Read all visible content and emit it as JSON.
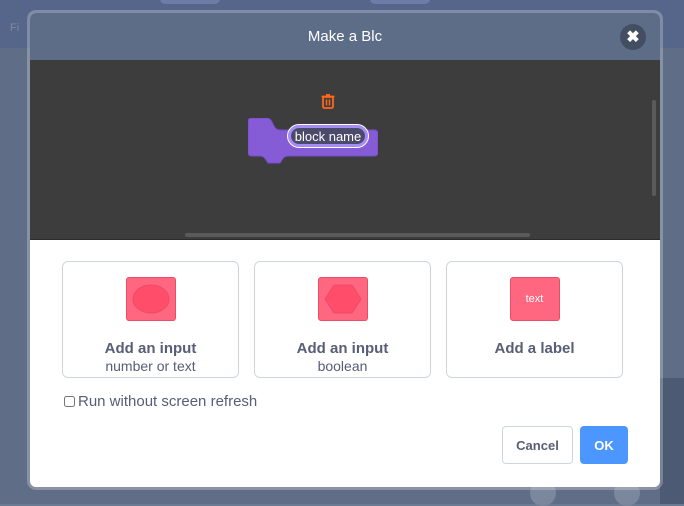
{
  "background": {
    "left_label": "Fi"
  },
  "modal": {
    "title": "Make a Blc",
    "close_icon": "close-icon"
  },
  "workspace": {
    "block_name": "block name",
    "block_color": "#855cd6",
    "trash_icon": "trash-icon"
  },
  "options": [
    {
      "title": "Add an input",
      "subtitle": "number or text",
      "icon": "oval-input-icon"
    },
    {
      "title": "Add an input",
      "subtitle": "boolean",
      "icon": "boolean-input-icon"
    },
    {
      "title": "Add a label",
      "subtitle": "",
      "icon": "label-icon",
      "icon_text": "text"
    }
  ],
  "refresh": {
    "label": "Run without screen refresh",
    "checked": false
  },
  "buttons": {
    "cancel": "Cancel",
    "ok": "OK"
  },
  "colors": {
    "accent": "#4c97ff",
    "input_pink": "#ff6680",
    "header": "#5d6d88"
  }
}
